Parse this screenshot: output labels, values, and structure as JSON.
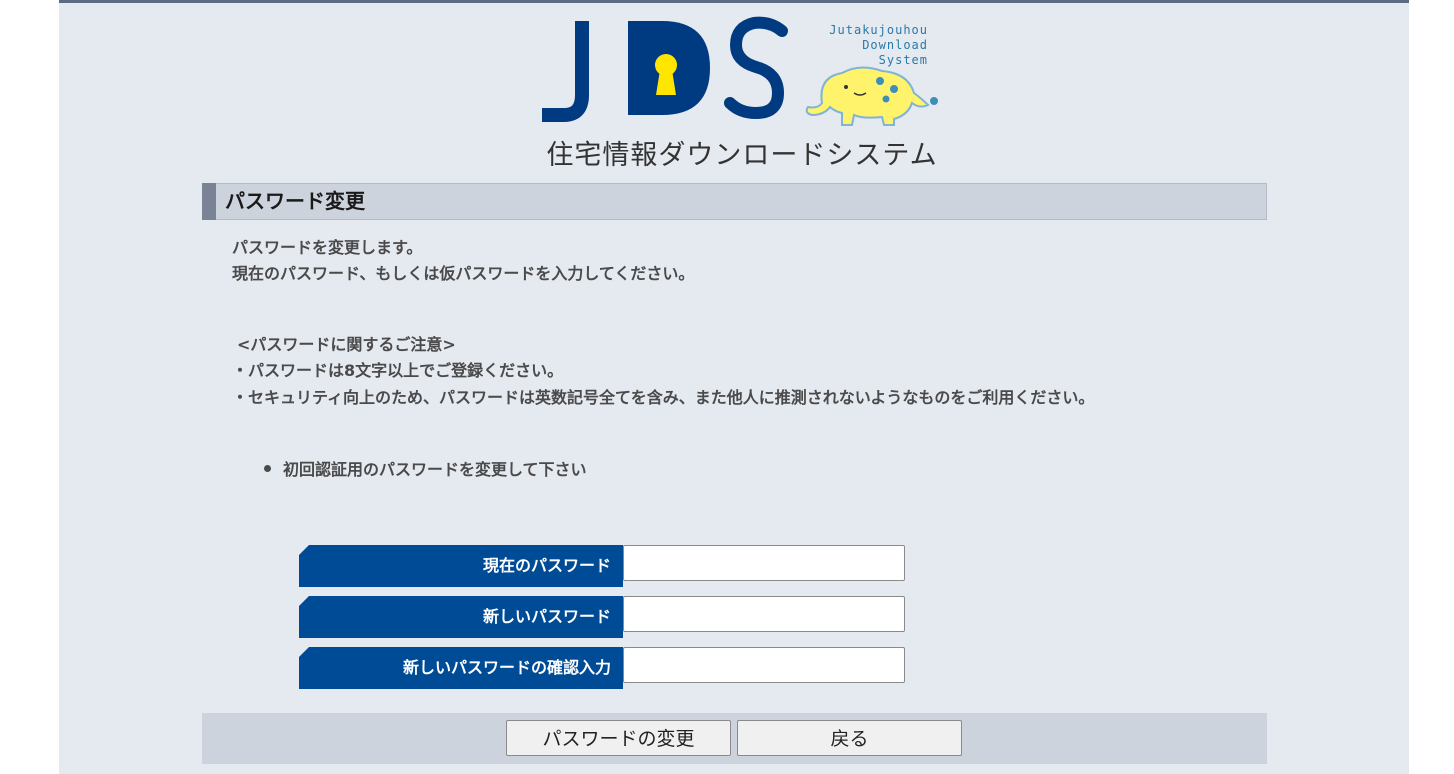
{
  "logo": {
    "letters": "JDS",
    "english_lines": [
      "Jutakujouhou",
      "Download",
      "System"
    ],
    "subtitle": "住宅情報ダウンロードシステム",
    "colors": {
      "letters": "#003a80",
      "keyhole": "#ffe600",
      "elephant": "#fff36b",
      "elephant_outline": "#7fb4d4"
    }
  },
  "section": {
    "title": "パスワード変更"
  },
  "intro": [
    "パスワードを変更します。",
    "現在のパスワード、もしくは仮パスワードを入力してください。"
  ],
  "notes": [
    "<パスワードに関するご注意>",
    "・パスワードは8文字以上でご登録ください。",
    "・セキュリティ向上のため、パスワードは英数記号全てを含み、また他人に推測されないようなものをご利用ください。"
  ],
  "bullet": "初回認証用のパスワードを変更して下さい",
  "form": {
    "current_password_label": "現在のパスワード",
    "current_password_value": "",
    "new_password_label": "新しいパスワード",
    "new_password_value": "",
    "confirm_password_label": "新しいパスワードの確認入力",
    "confirm_password_value": ""
  },
  "buttons": {
    "change": "パスワードの変更",
    "back": "戻る"
  },
  "colors": {
    "page_bg": "#e5e9f0",
    "label_bg": "#004b96",
    "header_bg": "#cdd3dc"
  }
}
